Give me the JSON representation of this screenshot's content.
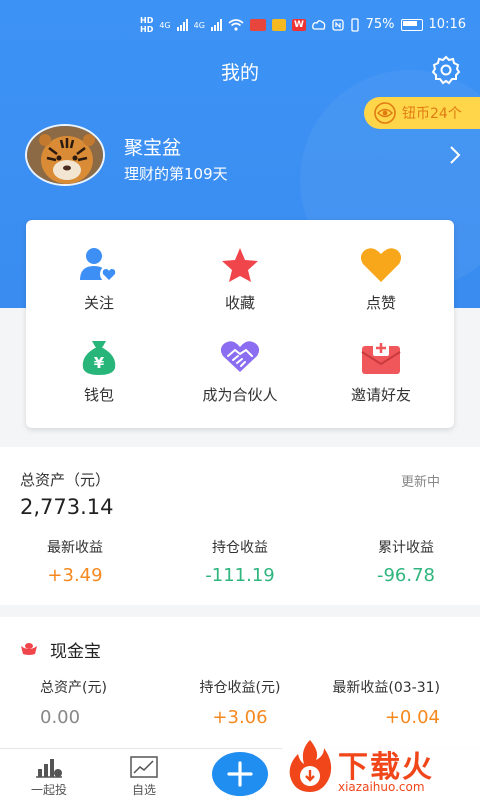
{
  "status_bar": {
    "sim1": "HD",
    "sim2": "HD",
    "net1": "4G",
    "net2": "4G",
    "battery_percent": "75%",
    "time": "10:16"
  },
  "header": {
    "title": "我的",
    "coins_label": "钮币24个"
  },
  "profile": {
    "name": "聚宝盆",
    "days_text": "理财的第109天"
  },
  "quick_actions": [
    {
      "label": "关注",
      "icon": "user-heart-icon"
    },
    {
      "label": "收藏",
      "icon": "star-icon"
    },
    {
      "label": "点赞",
      "icon": "heart-icon"
    },
    {
      "label": "钱包",
      "icon": "money-bag-icon"
    },
    {
      "label": "成为合伙人",
      "icon": "handshake-icon"
    },
    {
      "label": "邀请好友",
      "icon": "invite-envelope-icon"
    }
  ],
  "assets": {
    "label": "总资产（元）",
    "status": "更新中",
    "total": "2,773.14",
    "stats": [
      {
        "label": "最新收益",
        "value": "+3.49",
        "color": "#f5891f"
      },
      {
        "label": "持仓收益",
        "value": "-111.19",
        "color": "#2fb57e"
      },
      {
        "label": "累计收益",
        "value": "-96.78",
        "color": "#2fb57e"
      }
    ]
  },
  "cash": {
    "title": "现金宝",
    "stats": [
      {
        "label": "总资产(元)",
        "value": "0.00"
      },
      {
        "label": "持仓收益(元)",
        "value": "+3.06"
      },
      {
        "label": "最新收益(03-31)",
        "value": "+0.04"
      }
    ]
  },
  "bottom_nav": [
    {
      "label": "一起投",
      "icon": "bar-chart-icon"
    },
    {
      "label": "自选",
      "icon": "trend-chart-icon"
    }
  ],
  "watermark": {
    "main": "下载火",
    "sub": "xiazaihuo.com"
  },
  "colors": {
    "brand_blue": "#3b8ff2",
    "gain": "#f5891f",
    "loss": "#2fb57e",
    "badge": "#ffd64a"
  }
}
